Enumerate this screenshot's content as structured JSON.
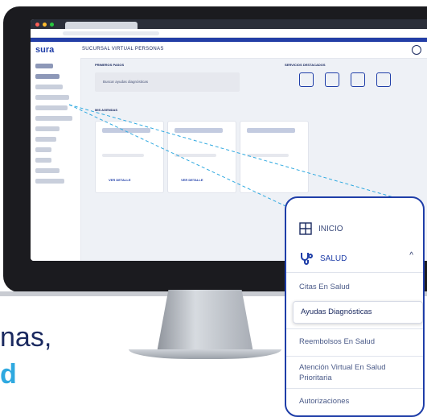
{
  "screen": {
    "logo": "sura",
    "app_title": "SUCURSAL VIRTUAL PERSONAS",
    "section_left": "PRIMEROS PASOS",
    "section_right": "SERVICIOS DESTACADOS",
    "search_placeholder": "Buscar ayudas diagnósticas",
    "section_mid": "MIS AGENDAS",
    "card_link": "VER DETALLE"
  },
  "hero": {
    "line1": "nas,",
    "line2": "d"
  },
  "zoom_menu": {
    "inicio": "INICIO",
    "salud": "SALUD",
    "citas": "Citas En Salud",
    "ayudas": "Ayudas Diagnósticas",
    "reembolsos": "Reembolsos En Salud",
    "atencion": "Atención Virtual En Salud Prioritaria",
    "autorizaciones": "Autorizaciones"
  },
  "colors": {
    "brand": "#1f3ea8",
    "accent": "#2fa9e0",
    "text": "#1b2a60"
  }
}
